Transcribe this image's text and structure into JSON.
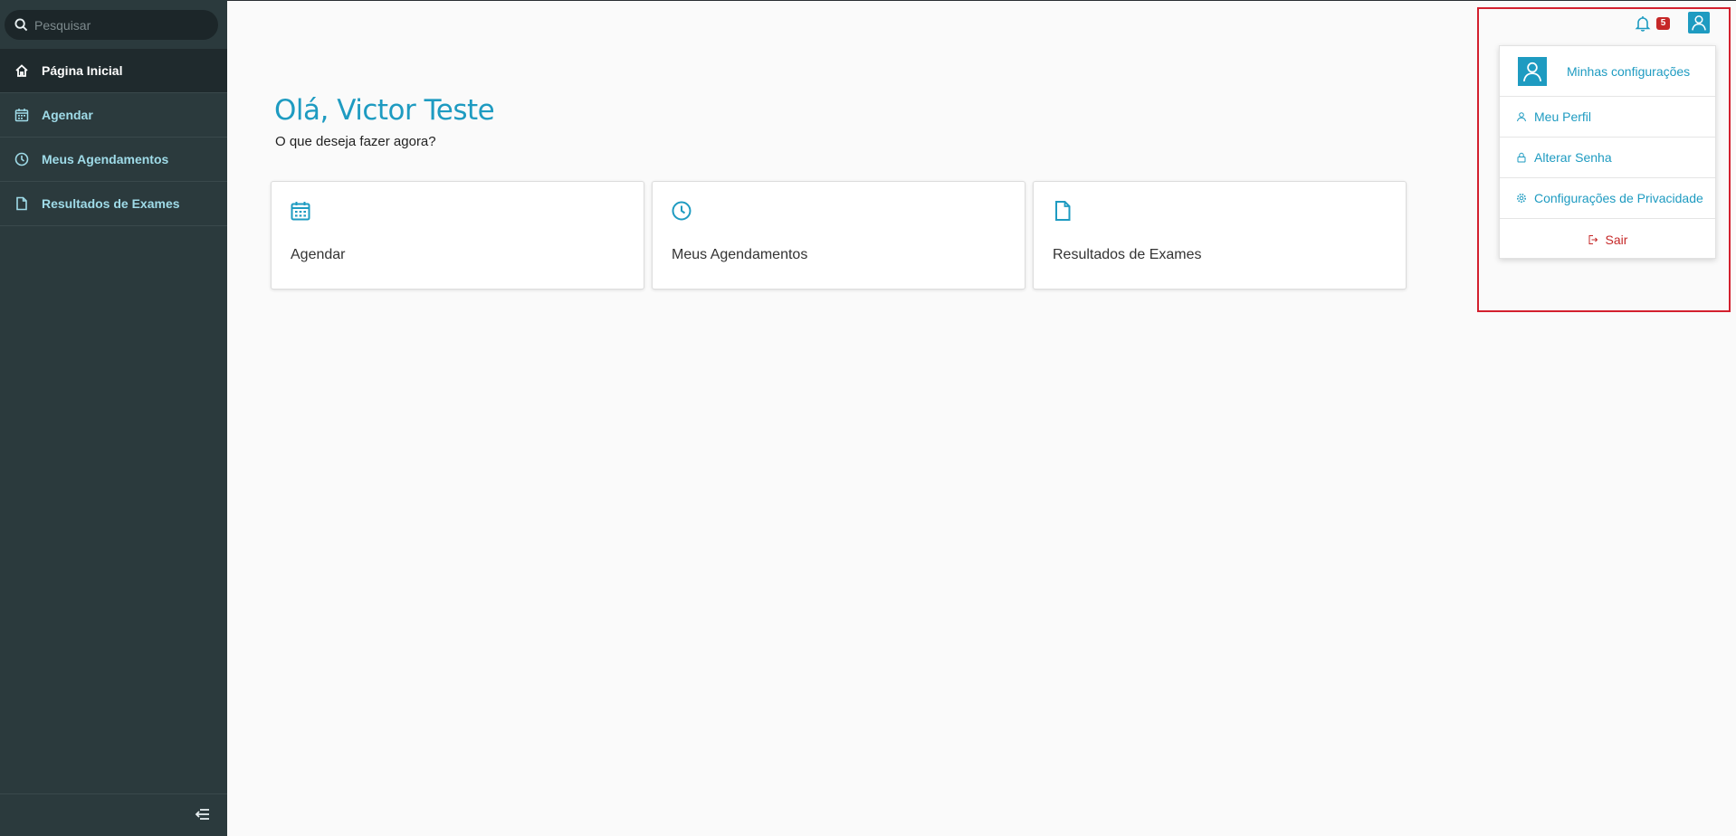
{
  "search": {
    "placeholder": "Pesquisar"
  },
  "sidebar": {
    "items": [
      {
        "label": "Página Inicial",
        "icon": "home-icon"
      },
      {
        "label": "Agendar",
        "icon": "calendar-icon"
      },
      {
        "label": "Meus Agendamentos",
        "icon": "clock-icon"
      },
      {
        "label": "Resultados de Exames",
        "icon": "document-icon"
      }
    ],
    "collapse_icon": "collapse-menu-icon"
  },
  "main": {
    "greeting": "Olá, Victor Teste",
    "subtitle": "O que deseja fazer agora?",
    "cards": [
      {
        "label": "Agendar",
        "icon": "calendar-icon"
      },
      {
        "label": "Meus Agendamentos",
        "icon": "clock-icon"
      },
      {
        "label": "Resultados de Exames",
        "icon": "document-icon"
      }
    ]
  },
  "header": {
    "notifications_count": "5",
    "bell_icon": "bell-icon",
    "user_icon": "user-icon"
  },
  "dropdown": {
    "header_label": "Minhas configurações",
    "items": [
      {
        "label": "Meu Perfil",
        "icon": "user-icon"
      },
      {
        "label": "Alterar Senha",
        "icon": "lock-icon"
      },
      {
        "label": "Configurações de Privacidade",
        "icon": "gear-icon"
      },
      {
        "label": "Sair",
        "icon": "logout-icon"
      }
    ]
  },
  "colors": {
    "sidebar_bg": "#2b3a3d",
    "accent": "#1e9bc1",
    "danger": "#c62828",
    "highlight": "#d3202e"
  }
}
